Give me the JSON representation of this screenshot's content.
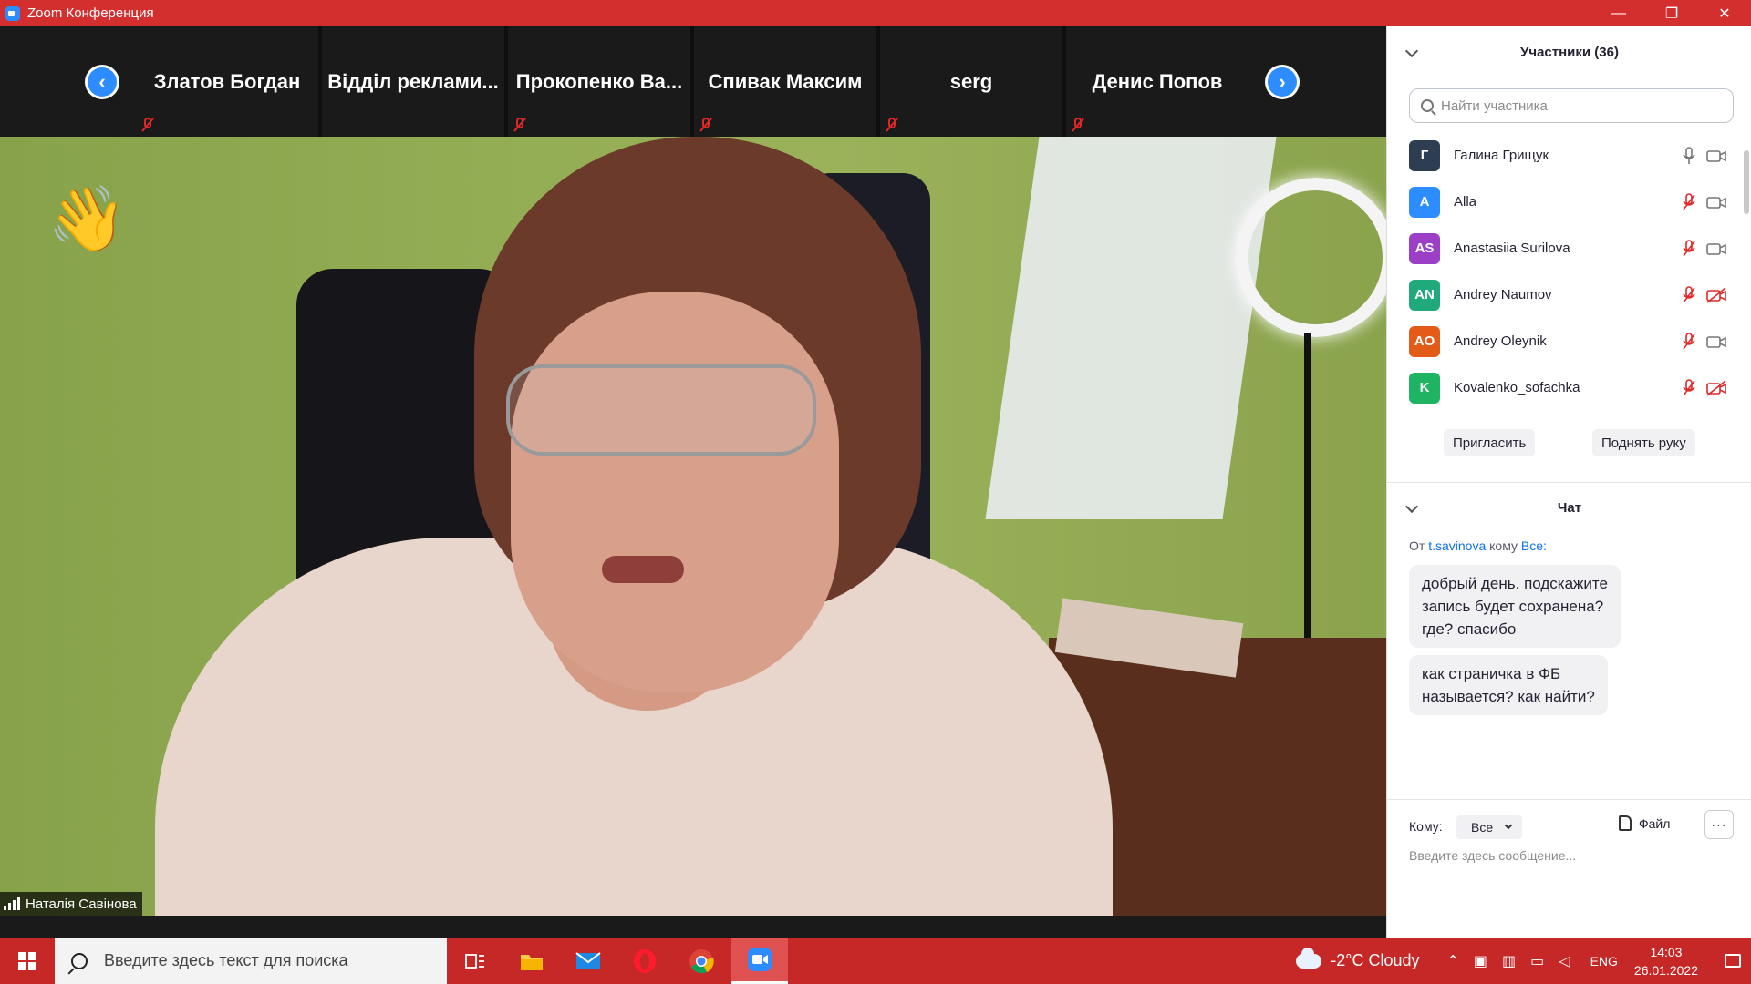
{
  "window": {
    "title": "Zoom Конференция",
    "controls": [
      "—",
      "❐",
      "✕"
    ]
  },
  "strip": {
    "tiles": [
      {
        "name": "Златов Богдан",
        "muted": true
      },
      {
        "name": "Відділ реклами...",
        "muted": false
      },
      {
        "name": "Прокопенко Ва...",
        "muted": true
      },
      {
        "name": "Спивак Максим",
        "muted": true
      },
      {
        "name": "serg",
        "muted": true
      },
      {
        "name": "Денис Попов",
        "muted": true
      }
    ]
  },
  "main_video": {
    "speaker_name": "Наталія Савінова",
    "reaction": "👋"
  },
  "participants": {
    "title": "Участники (36)",
    "search_placeholder": "Найти участника",
    "list": [
      {
        "initials": "Г",
        "name": "Галина Грищук",
        "color": "#2e3e52",
        "mic": "on",
        "video": "off"
      },
      {
        "initials": "A",
        "name": "Alla",
        "color": "#2d8cff",
        "mic": "muted",
        "video": "off"
      },
      {
        "initials": "AS",
        "name": "Anastasiia Surilova",
        "color": "#9b3fc6",
        "mic": "muted",
        "video": "off"
      },
      {
        "initials": "AN",
        "name": "Andrey Naumov",
        "color": "#20a97a",
        "mic": "muted",
        "video": "stopped"
      },
      {
        "initials": "AO",
        "name": "Andrey Oleynik",
        "color": "#e45a17",
        "mic": "muted",
        "video": "off"
      },
      {
        "initials": "K",
        "name": "Kovalenko_sofachka",
        "color": "#1fb364",
        "mic": "muted",
        "video": "stopped"
      }
    ],
    "invite_label": "Пригласить",
    "raise_hand_label": "Поднять руку"
  },
  "chat": {
    "title": "Чат",
    "from_prefix": "От",
    "from_user": "t.savinova",
    "to_prefix": "кому",
    "to_user": "Все:",
    "messages": [
      "добрый день. подскажите\nзапись будет сохранена?\nгде? спасибо",
      "как страничка в ФБ\nназывается? как найти?"
    ],
    "to_label": "Кому:",
    "to_value": "Все",
    "file_label": "Файл",
    "more_label": "···",
    "input_placeholder": "Введите здесь сообщение..."
  },
  "taskbar": {
    "search_placeholder": "Введите здесь текст для поиска",
    "weather": "-2°C  Cloudy",
    "lang": "ENG",
    "time": "14:03",
    "date": "26.01.2022"
  },
  "colors": {
    "zoom_blue": "#2d8cff",
    "titlebar_red": "#d32f2f",
    "taskbar_red": "#c62828",
    "muted_red": "#e02828"
  }
}
